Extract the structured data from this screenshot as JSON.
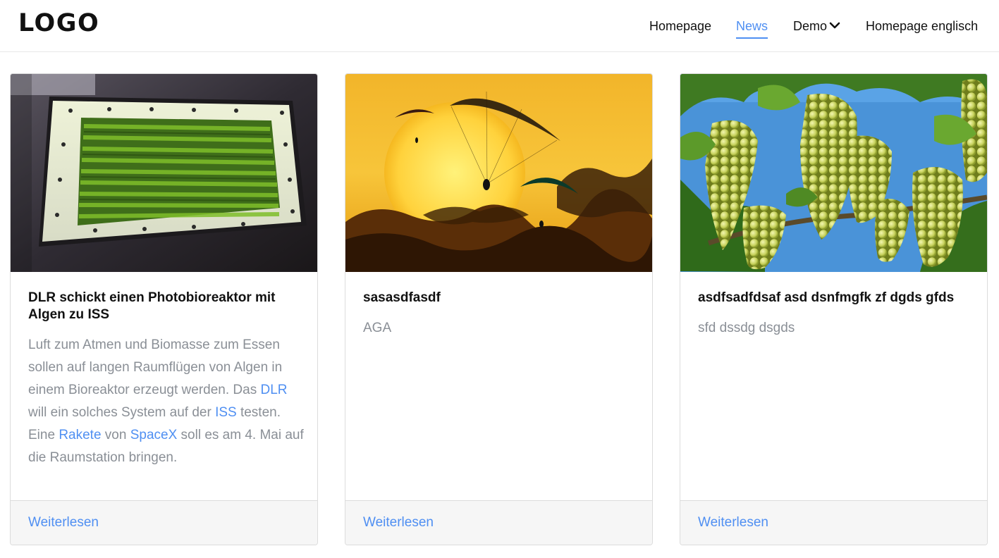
{
  "header": {
    "logo": "LOGO",
    "nav": [
      {
        "label": "Homepage",
        "active": false
      },
      {
        "label": "News",
        "active": true
      },
      {
        "label": "Demo",
        "active": false,
        "has_dropdown": true
      },
      {
        "label": "Homepage englisch",
        "active": false
      }
    ],
    "active_color": "#4f8ff2"
  },
  "cards": [
    {
      "image": "photobioreactor-algae-photo",
      "title": "DLR schickt einen Photobioreaktor mit Algen zu ISS",
      "text_parts": [
        "Luft zum Atmen und Biomasse zum Essen sollen auf langen Raumflügen von Algen in einem Bioreaktor erzeugt werden. Das ",
        "DLR",
        " will ein solches System auf der ",
        "ISS",
        " testen. Eine ",
        "Rakete",
        " von ",
        "SpaceX",
        " soll es am 4. Mai auf die Raumstation bringen."
      ],
      "link_label": "Weiterlesen"
    },
    {
      "image": "paragliders-sunset-photo",
      "title": "sasasdfasdf",
      "text": "AGA",
      "link_label": "Weiterlesen"
    },
    {
      "image": "white-grapes-vine-photo",
      "title": "asdfsadfdsaf asd dsnfmgfk zf dgds gfds",
      "text": "sfd dssdg dsgds",
      "link_label": "Weiterlesen"
    }
  ],
  "colors": {
    "link": "#4f8ff2",
    "body_text": "#8a8f96",
    "footer_bg": "#f6f6f6"
  }
}
